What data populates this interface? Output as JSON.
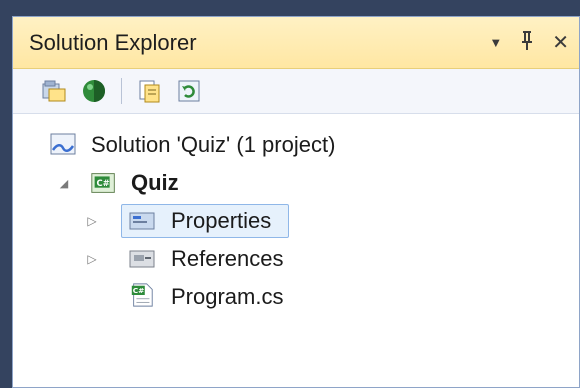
{
  "panel": {
    "title": "Solution Explorer",
    "controls": {
      "dropdown": "▼",
      "pin": "ᛉ",
      "close": "✕"
    }
  },
  "toolbar": {
    "buttons": [
      {
        "name": "properties-icon"
      },
      {
        "name": "show-all-files-icon"
      },
      {
        "name": "view-code-icon"
      },
      {
        "name": "refresh-icon"
      }
    ]
  },
  "tree": {
    "solution": {
      "label": "Solution 'Quiz' (1 project)"
    },
    "project": {
      "label": "Quiz",
      "expander": "◢"
    },
    "items": [
      {
        "label": "Properties",
        "expander": "▷",
        "selected": true
      },
      {
        "label": "References",
        "expander": "▷"
      },
      {
        "label": "Program.cs"
      }
    ]
  },
  "colors": {
    "title_bg": "#ffe7a3",
    "selection_border": "#8fb7e8",
    "selection_bg": "#e6f1fc",
    "csharp_green": "#2e8b3a"
  }
}
